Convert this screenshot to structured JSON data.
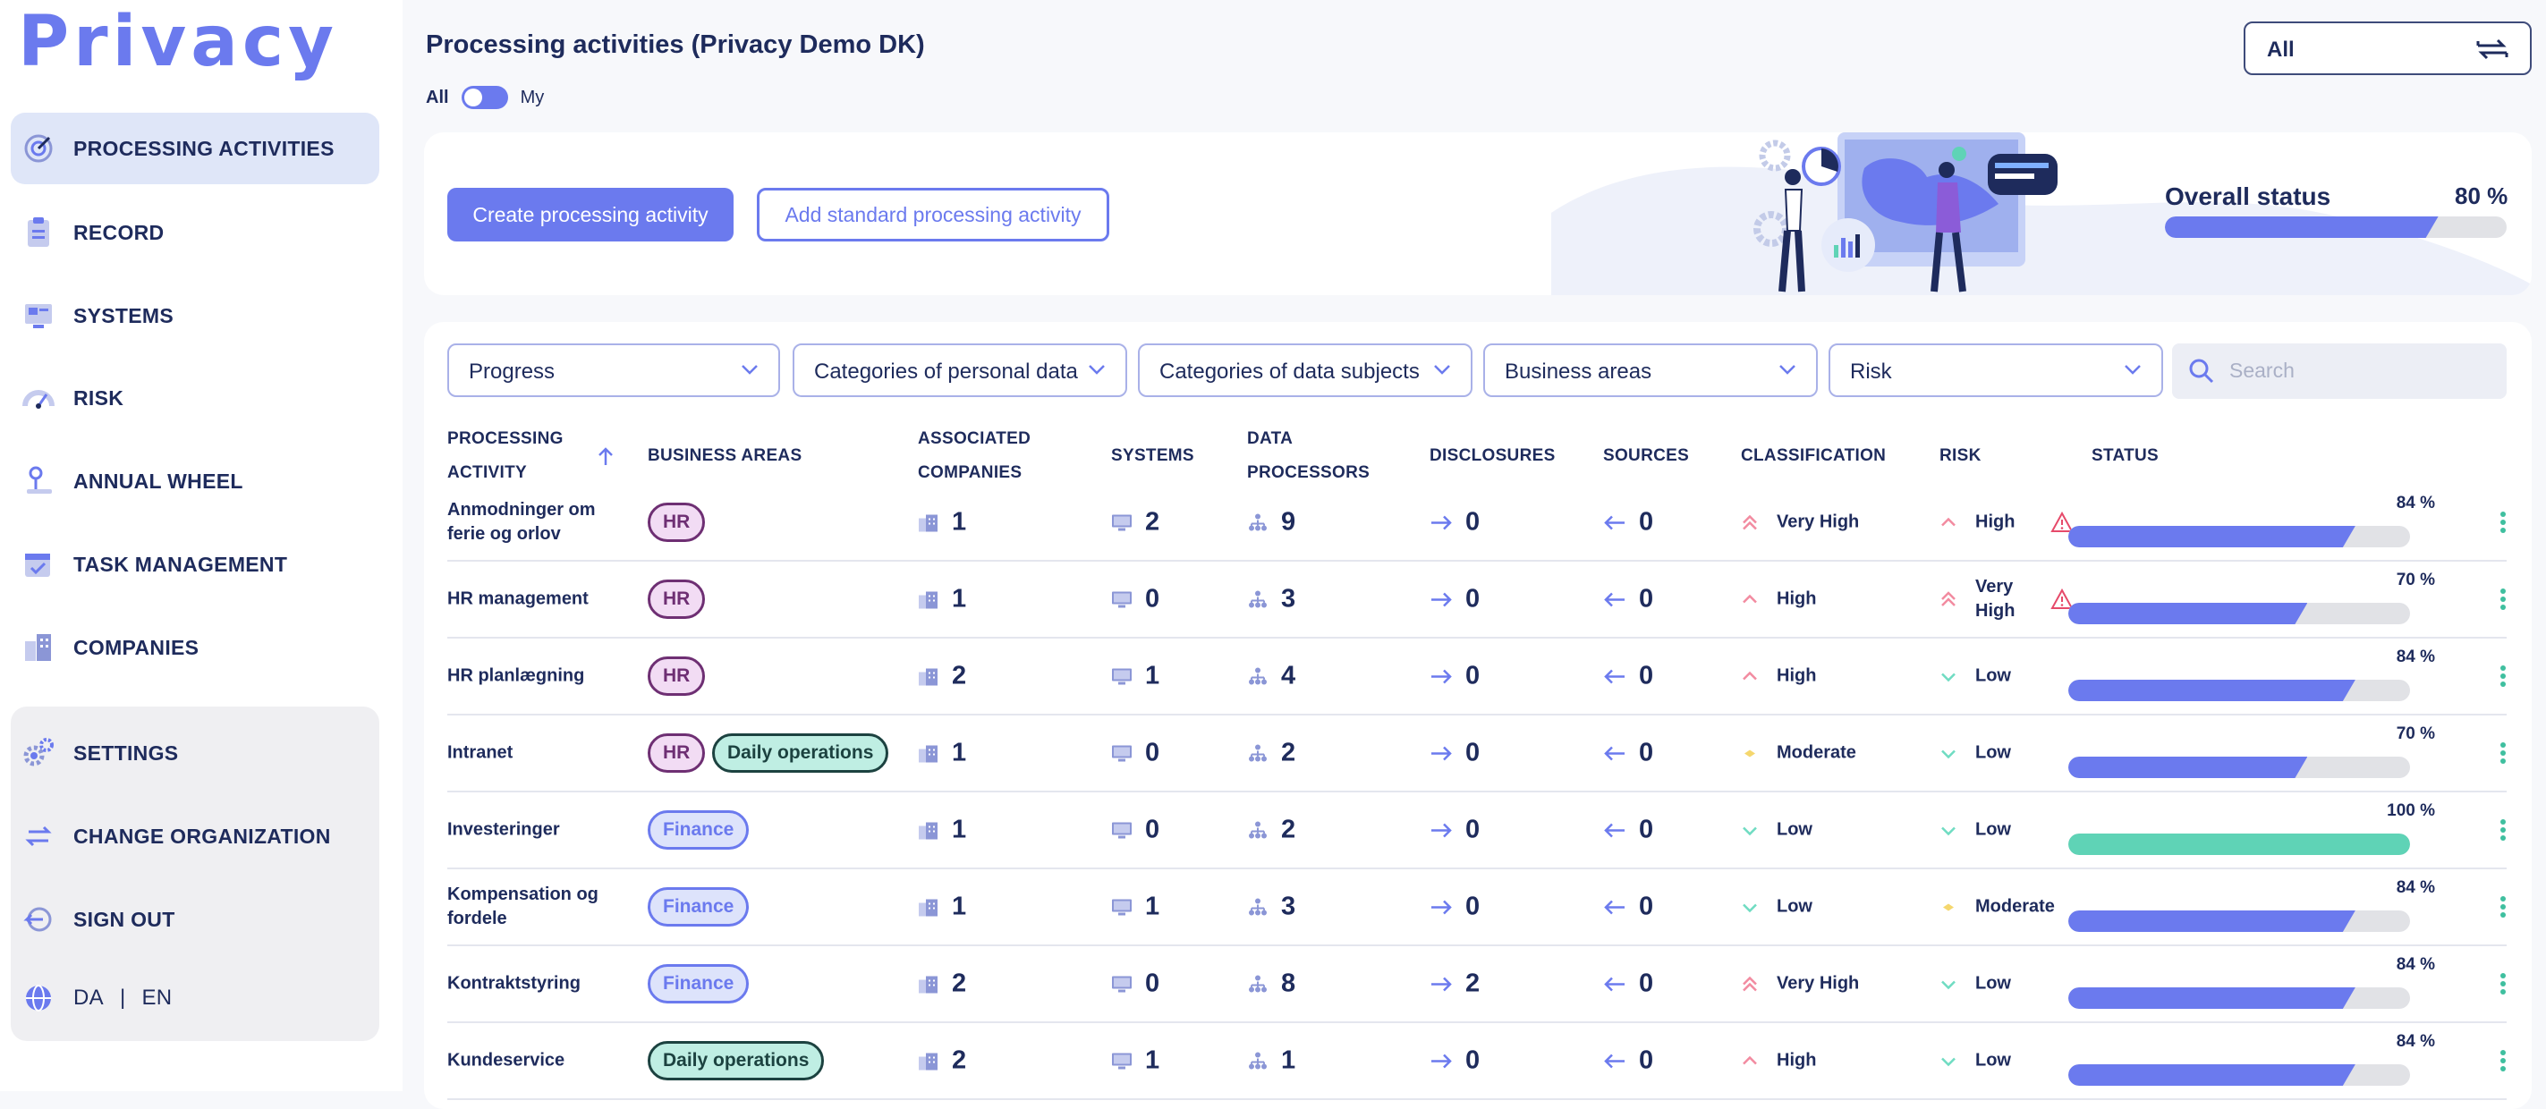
{
  "app": {
    "logo": "Privacy"
  },
  "sidebar": {
    "items": [
      {
        "label": "PROCESSING ACTIVITIES",
        "icon": "processing-icon",
        "active": true
      },
      {
        "label": "RECORD",
        "icon": "clipboard-icon"
      },
      {
        "label": "SYSTEMS",
        "icon": "systems-icon"
      },
      {
        "label": "RISK",
        "icon": "gauge-icon"
      },
      {
        "label": "ANNUAL WHEEL",
        "icon": "annual-wheel-icon"
      },
      {
        "label": "TASK MANAGEMENT",
        "icon": "calendar-task-icon"
      },
      {
        "label": "COMPANIES",
        "icon": "buildings-icon"
      }
    ],
    "bottom": [
      {
        "label": "SETTINGS",
        "icon": "gears-icon"
      },
      {
        "label": "CHANGE ORGANIZATION",
        "icon": "swap-icon"
      },
      {
        "label": "SIGN OUT",
        "icon": "sign-out-icon"
      }
    ],
    "lang": {
      "icon": "globe-icon",
      "da": "DA",
      "sep": "|",
      "en": "EN"
    }
  },
  "header": {
    "title": "Processing activities (Privacy Demo DK)",
    "toggle_left": "All",
    "toggle_right": "My",
    "org_select": "All"
  },
  "hero": {
    "create_button": "Create processing activity",
    "standard_button": "Add standard processing activity",
    "overall_label": "Overall status",
    "overall_value": "80 %",
    "overall_fraction": 0.8
  },
  "filters": {
    "progress": "Progress",
    "categories_personal": "Categories of personal data",
    "categories_subjects": "Categories of data subjects",
    "business_areas": "Business areas",
    "risk": "Risk",
    "search_placeholder": "Search"
  },
  "table": {
    "columns": {
      "activity_1": "PROCESSING",
      "activity_2": "ACTIVITY",
      "business": "BUSINESS AREAS",
      "companies_1": "ASSOCIATED",
      "companies_2": "COMPANIES",
      "systems": "SYSTEMS",
      "processors_1": "DATA",
      "processors_2": "PROCESSORS",
      "disclosures": "DISCLOSURES",
      "sources": "SOURCES",
      "classification": "CLASSIFICATION",
      "risk": "RISK",
      "status": "STATUS"
    },
    "rows": [
      {
        "name": "Anmodninger om ferie og orlov",
        "tags": [
          {
            "label": "HR",
            "kind": "HR"
          }
        ],
        "companies": "1",
        "systems": "2",
        "processors": "9",
        "disclosures": "0",
        "sources": "0",
        "classification": "Very High",
        "class_level": "veryhigh",
        "risk": "High",
        "risk_level": "high",
        "warning": true,
        "status": "84 %",
        "status_fraction": 0.84
      },
      {
        "name": "HR management",
        "tags": [
          {
            "label": "HR",
            "kind": "HR"
          }
        ],
        "companies": "1",
        "systems": "0",
        "processors": "3",
        "disclosures": "0",
        "sources": "0",
        "classification": "High",
        "class_level": "high",
        "risk": "Very High",
        "risk_level": "veryhigh",
        "warning": true,
        "status": "70 %",
        "status_fraction": 0.7
      },
      {
        "name": "HR planlægning",
        "tags": [
          {
            "label": "HR",
            "kind": "HR"
          }
        ],
        "companies": "2",
        "systems": "1",
        "processors": "4",
        "disclosures": "0",
        "sources": "0",
        "classification": "High",
        "class_level": "high",
        "risk": "Low",
        "risk_level": "low",
        "warning": false,
        "status": "84 %",
        "status_fraction": 0.84
      },
      {
        "name": "Intranet",
        "tags": [
          {
            "label": "HR",
            "kind": "HR"
          },
          {
            "label": "Daily operations",
            "kind": "Daily"
          }
        ],
        "companies": "1",
        "systems": "0",
        "processors": "2",
        "disclosures": "0",
        "sources": "0",
        "classification": "Moderate",
        "class_level": "moderate",
        "risk": "Low",
        "risk_level": "low",
        "warning": false,
        "status": "70 %",
        "status_fraction": 0.7
      },
      {
        "name": "Investeringer",
        "tags": [
          {
            "label": "Finance",
            "kind": "Finance"
          }
        ],
        "companies": "1",
        "systems": "0",
        "processors": "2",
        "disclosures": "0",
        "sources": "0",
        "classification": "Low",
        "class_level": "low",
        "risk": "Low",
        "risk_level": "low",
        "warning": false,
        "status": "100 %",
        "status_fraction": 1.0
      },
      {
        "name": "Kompensation og fordele",
        "tags": [
          {
            "label": "Finance",
            "kind": "Finance"
          }
        ],
        "companies": "1",
        "systems": "1",
        "processors": "3",
        "disclosures": "0",
        "sources": "0",
        "classification": "Low",
        "class_level": "low",
        "risk": "Moderate",
        "risk_level": "moderate",
        "warning": false,
        "status": "84 %",
        "status_fraction": 0.84
      },
      {
        "name": "Kontraktstyring",
        "tags": [
          {
            "label": "Finance",
            "kind": "Finance"
          }
        ],
        "companies": "2",
        "systems": "0",
        "processors": "8",
        "disclosures": "2",
        "sources": "0",
        "classification": "Very High",
        "class_level": "veryhigh",
        "risk": "Low",
        "risk_level": "low",
        "warning": false,
        "status": "84 %",
        "status_fraction": 0.84
      },
      {
        "name": "Kundeservice",
        "tags": [
          {
            "label": "Daily operations",
            "kind": "Daily"
          }
        ],
        "companies": "2",
        "systems": "1",
        "processors": "1",
        "disclosures": "0",
        "sources": "0",
        "classification": "High",
        "class_level": "high",
        "risk": "Low",
        "risk_level": "low",
        "warning": false,
        "status": "84 %",
        "status_fraction": 0.84
      }
    ]
  },
  "colors": {
    "accent": "#6b7aee",
    "navy": "#1e2b5c",
    "green": "#5fd3b6",
    "pink": "#f28ba0",
    "warn": "#e64a6a"
  }
}
